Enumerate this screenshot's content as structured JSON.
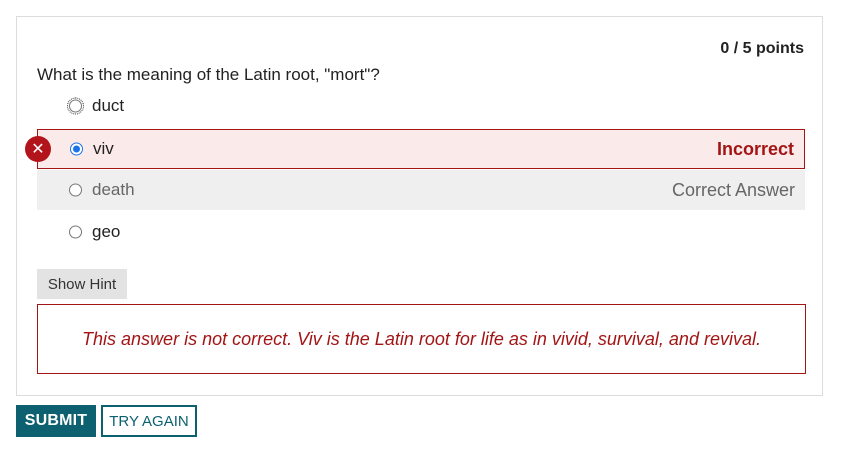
{
  "quiz": {
    "points": "0 / 5 points",
    "question": "What is the meaning of the Latin root, \"mort\"?",
    "options": [
      {
        "label": "duct"
      },
      {
        "label": "viv",
        "status": "Incorrect"
      },
      {
        "label": "death",
        "status": "Correct Answer"
      },
      {
        "label": "geo"
      }
    ],
    "hint_label": "Show Hint",
    "feedback": "This answer is not correct. Viv is the Latin root for life as in vivid, survival, and revival."
  },
  "actions": {
    "submit_label": "SUBMIT",
    "try_again_label": "TRY AGAIN"
  },
  "colors": {
    "error": "#a31515",
    "accent": "#0d6070",
    "radio_selected": "#1a73e8"
  },
  "icons": {
    "incorrect_marker": "close-circle-icon"
  }
}
